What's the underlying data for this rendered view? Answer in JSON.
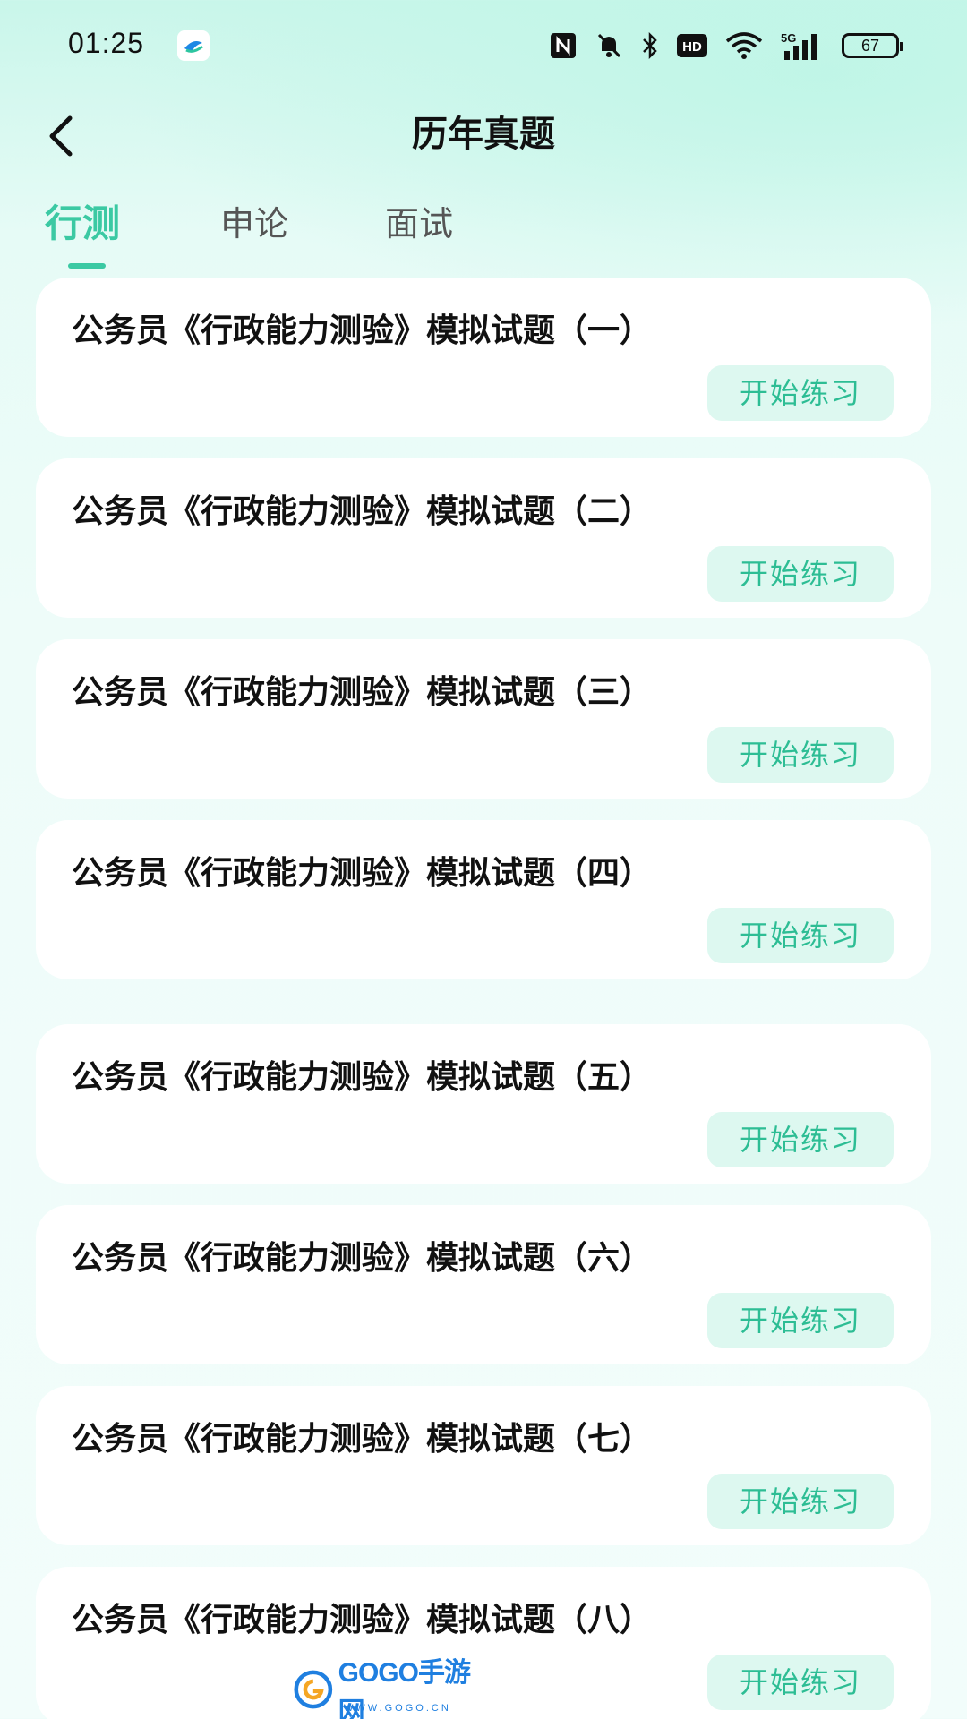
{
  "status_bar": {
    "time": "01:25",
    "battery": "67",
    "network": "5G",
    "hd": "HD",
    "icons": [
      "nfc-icon",
      "mute-bell-icon",
      "bluetooth-icon",
      "hd-icon",
      "wifi-icon",
      "signal-5g-icon",
      "battery-icon"
    ]
  },
  "header": {
    "title": "历年真题",
    "back_icon": "chevron-left-icon"
  },
  "tabs": [
    {
      "label": "行测",
      "active": true
    },
    {
      "label": "申论",
      "active": false
    },
    {
      "label": "面试",
      "active": false
    }
  ],
  "papers": [
    {
      "title": "公务员《行政能力测验》模拟试题（一）",
      "action": "开始练习"
    },
    {
      "title": "公务员《行政能力测验》模拟试题（二）",
      "action": "开始练习"
    },
    {
      "title": "公务员《行政能力测验》模拟试题（三）",
      "action": "开始练习"
    },
    {
      "title": "公务员《行政能力测验》模拟试题（四）",
      "action": "开始练习"
    },
    {
      "title": "公务员《行政能力测验》模拟试题（五）",
      "action": "开始练习"
    },
    {
      "title": "公务员《行政能力测验》模拟试题（六）",
      "action": "开始练习"
    },
    {
      "title": "公务员《行政能力测验》模拟试题（七）",
      "action": "开始练习"
    },
    {
      "title": "公务员《行政能力测验》模拟试题（八）",
      "action": "开始练习"
    }
  ],
  "watermark": {
    "text": "GOGO手游网",
    "sub": "WWW.GOGO.CN"
  },
  "colors": {
    "accent": "#3bc9a3",
    "button_bg": "#ddf8f0",
    "button_text": "#2dbd94"
  }
}
